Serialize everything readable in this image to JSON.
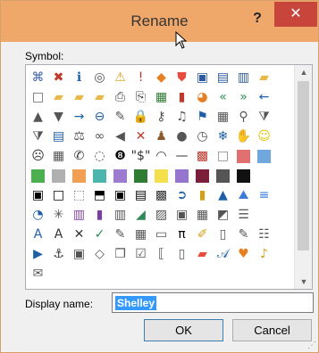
{
  "dialog": {
    "title": "Rename",
    "help_label": "?",
    "close_label": "✕",
    "symbol_label": "Symbol:",
    "display_name_label": "Display name:",
    "display_name_value": "Shelley",
    "ok_label": "OK",
    "cancel_label": "Cancel"
  },
  "symbols": [
    {
      "name": "org-chart-icon",
      "g": "⌘",
      "c": "#3b5ea6"
    },
    {
      "name": "error-x-icon",
      "g": "✖",
      "c": "#c0392b"
    },
    {
      "name": "info-icon",
      "g": "ℹ",
      "c": "#1f5fa8"
    },
    {
      "name": "stop-circle-icon",
      "g": "◎",
      "c": "#555"
    },
    {
      "name": "warning-triangle-icon",
      "g": "⚠",
      "c": "#d4a017"
    },
    {
      "name": "exclamation-icon",
      "g": "!",
      "c": "#c0392b"
    },
    {
      "name": "diamond-warning-icon",
      "g": "◆",
      "c": "#e67e22"
    },
    {
      "name": "shield-icon",
      "g": "⛊",
      "c": "#e74c3c"
    },
    {
      "name": "save-icon",
      "g": "▣",
      "c": "#2c5aa0"
    },
    {
      "name": "save-all-icon",
      "g": "▤",
      "c": "#2c5aa0"
    },
    {
      "name": "save-as-icon",
      "g": "▥",
      "c": "#2c5aa0"
    },
    {
      "name": "folder-icon",
      "g": "▰",
      "c": "#e8b84a"
    },
    {
      "name": "new-document-icon",
      "g": "□",
      "c": "#666"
    },
    {
      "name": "open-folder-icon",
      "g": "▰",
      "c": "#e8b84a"
    },
    {
      "name": "folder-stack-icon",
      "g": "▰",
      "c": "#e8b84a"
    },
    {
      "name": "folder-open-icon",
      "g": "▰",
      "c": "#e8b84a"
    },
    {
      "name": "printer-icon",
      "g": "⎙",
      "c": "#444"
    },
    {
      "name": "print-preview-icon",
      "g": "⎘",
      "c": "#444"
    },
    {
      "name": "spreadsheet-icon",
      "g": "▦",
      "c": "#2e7d32"
    },
    {
      "name": "bar-chart-icon",
      "g": "▮",
      "c": "#c0392b"
    },
    {
      "name": "pie-chart-icon",
      "g": "◕",
      "c": "#e67e22"
    },
    {
      "name": "rewind-icon",
      "g": "«",
      "c": "#2e8b57"
    },
    {
      "name": "fast-forward-icon",
      "g": "»",
      "c": "#2e8b57"
    },
    {
      "name": "back-arrow-icon",
      "g": "←",
      "c": "#1f5fa8"
    },
    {
      "name": "up-triangle-icon",
      "g": "▲",
      "c": "#555"
    },
    {
      "name": "down-triangle-icon",
      "g": "▼",
      "c": "#555"
    },
    {
      "name": "right-arrow-icon",
      "g": "→",
      "c": "#1f5fa8"
    },
    {
      "name": "left-circle-arrow-icon",
      "g": "⊖",
      "c": "#1f5fa8"
    },
    {
      "name": "pin-icon",
      "g": "✎",
      "c": "#555"
    },
    {
      "name": "lock-icon",
      "g": "🔒",
      "c": "#d4a017"
    },
    {
      "name": "key-icon",
      "g": "⚷",
      "c": "#555"
    },
    {
      "name": "music-icon",
      "g": "♫",
      "c": "#555"
    },
    {
      "name": "flag-icon",
      "g": "⚑",
      "c": "#1f5fa8"
    },
    {
      "name": "table-icon",
      "g": "▦",
      "c": "#555"
    },
    {
      "name": "magnifier-icon",
      "g": "⚲",
      "c": "#555"
    },
    {
      "name": "filter-icon",
      "g": "⧩",
      "c": "#555"
    },
    {
      "name": "funnel-icon",
      "g": "⧩",
      "c": "#555"
    },
    {
      "name": "book-icon",
      "g": "▤",
      "c": "#1f5fa8"
    },
    {
      "name": "scales-icon",
      "g": "⚖",
      "c": "#555"
    },
    {
      "name": "rings-icon",
      "g": "∞",
      "c": "#555"
    },
    {
      "name": "speaker-icon",
      "g": "◀",
      "c": "#555"
    },
    {
      "name": "mute-icon",
      "g": "✕",
      "c": "#c0392b"
    },
    {
      "name": "person-icon",
      "g": "♟",
      "c": "#8b5a2b"
    },
    {
      "name": "user-icon",
      "g": "●",
      "c": "#555"
    },
    {
      "name": "clock-icon",
      "g": "◷",
      "c": "#555"
    },
    {
      "name": "snowflake-icon",
      "g": "❄",
      "c": "#1f5fa8"
    },
    {
      "name": "hand-icon",
      "g": "✋",
      "c": "#555"
    },
    {
      "name": "smiley-icon",
      "g": "☺",
      "c": "#e6c200"
    },
    {
      "name": "frown-icon",
      "g": "☹",
      "c": "#333"
    },
    {
      "name": "calculator-icon",
      "g": "▦",
      "c": "#555"
    },
    {
      "name": "phone-icon",
      "g": "✆",
      "c": "#333"
    },
    {
      "name": "piggy-bank-icon",
      "g": "◌",
      "c": "#555"
    },
    {
      "name": "eight-ball-icon",
      "g": "❽",
      "c": "#000"
    },
    {
      "name": "dollar-quote-icon",
      "g": "\"$\"",
      "c": "#333"
    },
    {
      "name": "eye-icon",
      "g": "◠",
      "c": "#333"
    },
    {
      "name": "dash-icon",
      "g": "—",
      "c": "#333"
    },
    {
      "name": "mosaic-icon",
      "g": "▩",
      "c": "#c0392b"
    },
    {
      "name": "square-outline-icon",
      "g": "□",
      "c": "#888"
    },
    {
      "name": "pink-swatch-icon",
      "sw": "#e07070"
    },
    {
      "name": "lightblue-swatch-icon",
      "sw": "#6fa8dc"
    },
    {
      "name": "green-swatch-icon",
      "sw": "#4caf50"
    },
    {
      "name": "gray-swatch-icon",
      "sw": "#b0b0b0"
    },
    {
      "name": "orange-swatch-icon",
      "sw": "#f0a050"
    },
    {
      "name": "teal-swatch-icon",
      "sw": "#4db6ac"
    },
    {
      "name": "purple-swatch-icon",
      "sw": "#9c7bd0"
    },
    {
      "name": "darkgreen-swatch-icon",
      "sw": "#2e7d32"
    },
    {
      "name": "yellow-swatch-icon",
      "sw": "#f4e04d"
    },
    {
      "name": "lavender-swatch-icon",
      "sw": "#9575cd"
    },
    {
      "name": "maroon-swatch-icon",
      "sw": "#7b1f3a"
    },
    {
      "name": "black-white-split-icon",
      "sw": "#555555"
    },
    {
      "name": "black-swatch-icon",
      "sw": "#111111"
    },
    {
      "name": "empty-cell-icon",
      "g": " ",
      "c": "#333"
    },
    {
      "name": "black-border-box-icon",
      "g": "▣",
      "c": "#000"
    },
    {
      "name": "white-border-box-icon",
      "g": "□",
      "c": "#000"
    },
    {
      "name": "dotted-box-icon",
      "g": "⬚",
      "c": "#777"
    },
    {
      "name": "half-box-icon",
      "g": "⬒",
      "c": "#000"
    },
    {
      "name": "bold-box-icon",
      "g": "▣",
      "c": "#000"
    },
    {
      "name": "stripe-box-icon",
      "g": "▤",
      "c": "#000"
    },
    {
      "name": "checker-icon",
      "g": "▩",
      "c": "#333"
    },
    {
      "name": "circle-arrow-icon",
      "g": "➲",
      "c": "#1f5fa8"
    },
    {
      "name": "column-chart-icon",
      "g": "▮",
      "c": "#d4a017"
    },
    {
      "name": "droplet-icon",
      "g": "▲",
      "c": "#1f5fa8"
    },
    {
      "name": "mountain-icon",
      "g": "⛰",
      "c": "#3b7dd8"
    },
    {
      "name": "bar-lines-icon",
      "g": "≡",
      "c": "#3b7dd8"
    },
    {
      "name": "pie-quarter-icon",
      "g": "◔",
      "c": "#1f5fa8"
    },
    {
      "name": "star-web-icon",
      "g": "✳",
      "c": "#555"
    },
    {
      "name": "books-icon",
      "g": "▥",
      "c": "#8e44ad"
    },
    {
      "name": "purple-book-icon",
      "g": "▮",
      "c": "#7b3fa0"
    },
    {
      "name": "columns-icon",
      "g": "▥",
      "c": "#555"
    },
    {
      "name": "area-chart-icon",
      "g": "◢",
      "c": "#2e8b57"
    },
    {
      "name": "image-icon",
      "g": "▨",
      "c": "#555"
    },
    {
      "name": "picture-frame-icon",
      "g": "▣",
      "c": "#555"
    },
    {
      "name": "map-icon",
      "g": "▦",
      "c": "#555"
    },
    {
      "name": "diagonal-icon",
      "g": "◩",
      "c": "#555"
    },
    {
      "name": "list-icon",
      "g": "☰",
      "c": "#555"
    },
    {
      "name": "empty-cell-icon-2",
      "g": " ",
      "c": "#333"
    },
    {
      "name": "letter-a-box-icon",
      "g": "A",
      "c": "#1f5fa8"
    },
    {
      "name": "letter-a-icon",
      "g": "A",
      "c": "#333"
    },
    {
      "name": "close-x-icon",
      "g": "✕",
      "c": "#333"
    },
    {
      "name": "checkmark-icon",
      "g": "✓",
      "c": "#2e8b57"
    },
    {
      "name": "edit-chart-icon",
      "g": "✎",
      "c": "#555"
    },
    {
      "name": "table-grid-icon",
      "g": "▦",
      "c": "#555"
    },
    {
      "name": "ruler-icon",
      "g": "▭",
      "c": "#555"
    },
    {
      "name": "pi-icon",
      "g": "π",
      "c": "#000"
    },
    {
      "name": "highlighter-icon",
      "g": "✐",
      "c": "#d4a017"
    },
    {
      "name": "document-icon",
      "g": "▯",
      "c": "#555"
    },
    {
      "name": "paint-brush-icon",
      "g": "✎",
      "c": "#555"
    },
    {
      "name": "bullets-icon",
      "g": "☷",
      "c": "#555"
    },
    {
      "name": "play-icon",
      "g": "▶",
      "c": "#1f5fa8"
    },
    {
      "name": "anchor-icon",
      "g": "⚓",
      "c": "#333"
    },
    {
      "name": "briefcase-icon",
      "g": "▣",
      "c": "#555"
    },
    {
      "name": "tag-icon",
      "g": "◇",
      "c": "#555"
    },
    {
      "name": "copy-icon",
      "g": "❐",
      "c": "#555"
    },
    {
      "name": "check-box-icon",
      "g": "☑",
      "c": "#555"
    },
    {
      "name": "brackets-icon",
      "g": "⟦",
      "c": "#555"
    },
    {
      "name": "pages-icon",
      "g": "▯",
      "c": "#555"
    },
    {
      "name": "eraser-icon",
      "g": "▰",
      "c": "#e74c3c"
    },
    {
      "name": "letter-a-script-icon",
      "g": "𝒜",
      "c": "#1f5fa8"
    },
    {
      "name": "heart-icon",
      "g": "♥",
      "c": "#e67e22"
    },
    {
      "name": "bell-icon",
      "g": "♪",
      "c": "#d4a017"
    },
    {
      "name": "envelope-icon",
      "g": "✉",
      "c": "#555"
    }
  ]
}
